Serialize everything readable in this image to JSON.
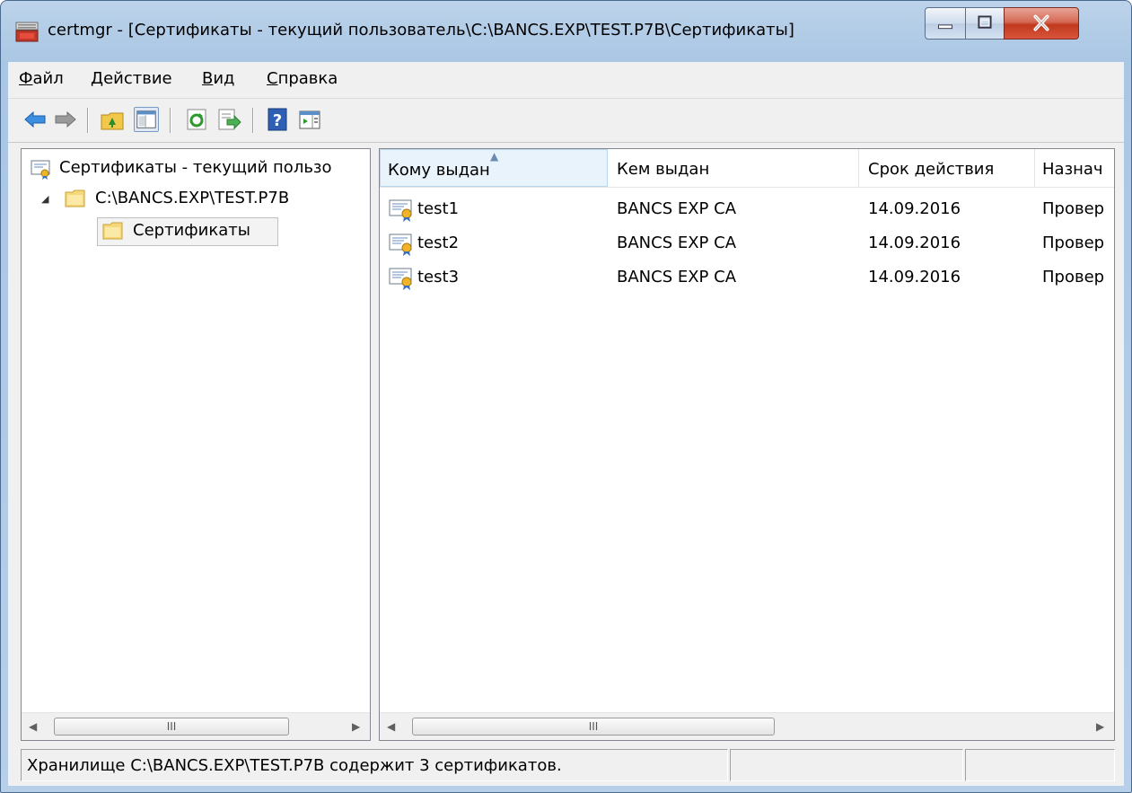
{
  "window": {
    "title": "certmgr - [Сертификаты - текущий пользователь\\C:\\BANCS.EXP\\TEST.P7B\\Сертификаты]"
  },
  "menu": [
    {
      "key": "Ф",
      "rest": "айл"
    },
    {
      "key": "Д",
      "rest": "ействие"
    },
    {
      "key": "В",
      "rest": "ид"
    },
    {
      "key": "С",
      "rest": "правка"
    }
  ],
  "toolbar": {
    "icons": [
      "back-icon",
      "forward-icon",
      "up-folder-icon",
      "show-hide-tree-icon",
      "refresh-icon",
      "export-icon",
      "help-icon",
      "show-action-pane-icon"
    ]
  },
  "tree": {
    "root": "Сертификаты - текущий пользо",
    "store": "C:\\BANCS.EXP\\TEST.P7B",
    "folder": "Сертификаты"
  },
  "list": {
    "columns": [
      "Кому выдан",
      "Кем выдан",
      "Срок действия",
      "Назнач"
    ],
    "rows": [
      {
        "issued_to": "test1",
        "issued_by": "BANCS EXP CA",
        "expires": "14.09.2016",
        "purpose": "Провер"
      },
      {
        "issued_to": "test2",
        "issued_by": "BANCS EXP CA",
        "expires": "14.09.2016",
        "purpose": "Провер"
      },
      {
        "issued_to": "test3",
        "issued_by": "BANCS EXP CA",
        "expires": "14.09.2016",
        "purpose": "Провер"
      }
    ]
  },
  "scrollbar": {
    "grip": "III"
  },
  "status": {
    "text": "Хранилище C:\\BANCS.EXP\\TEST.P7B содержит 3 сертификатов."
  }
}
